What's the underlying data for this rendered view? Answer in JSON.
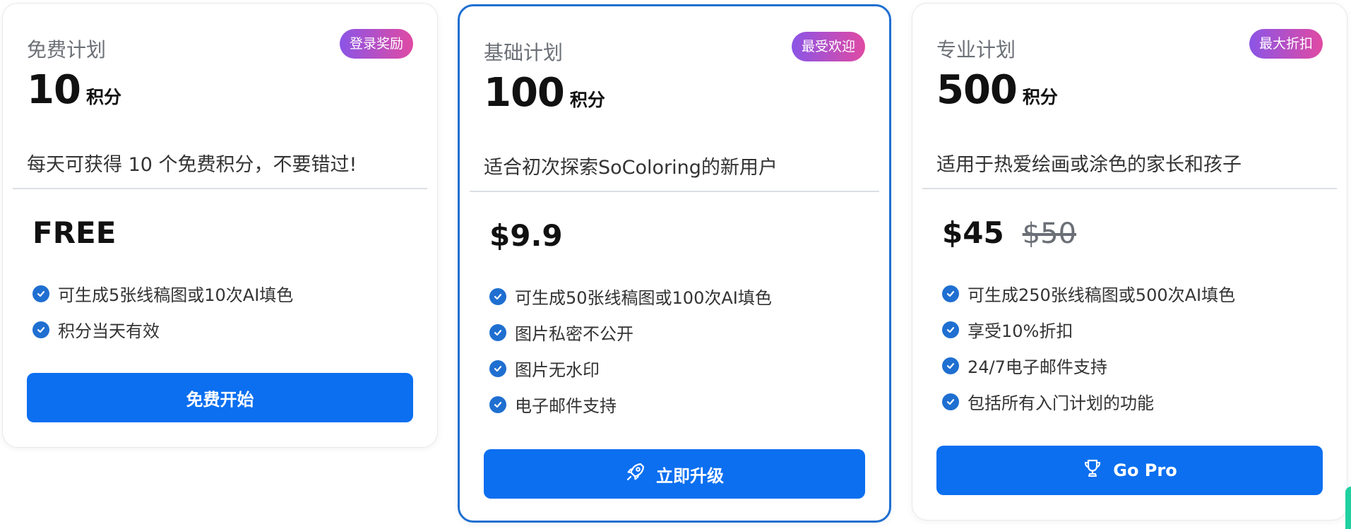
{
  "plans": [
    {
      "name": "免费计划",
      "badge": "登录奖励",
      "credits": "10",
      "credits_unit": "积分",
      "description": "每天可获得 10 个免费积分，不要错过!",
      "price": "FREE",
      "old_price": "",
      "features": [
        "可生成5张线稿图或10次AI填色",
        "积分当天有效"
      ],
      "cta_label": "免费开始",
      "cta_icon": ""
    },
    {
      "name": "基础计划",
      "badge": "最受欢迎",
      "credits": "100",
      "credits_unit": "积分",
      "description": "适合初次探索SoColoring的新用户",
      "price": "$9.9",
      "old_price": "",
      "features": [
        "可生成50张线稿图或100次AI填色",
        "图片私密不公开",
        "图片无水印",
        "电子邮件支持"
      ],
      "cta_label": "立即升级",
      "cta_icon": "rocket-icon"
    },
    {
      "name": "专业计划",
      "badge": "最大折扣",
      "credits": "500",
      "credits_unit": "积分",
      "description": "适用于热爱绘画或涂色的家长和孩子",
      "price": "$45",
      "old_price": "$50",
      "features": [
        "可生成250张线稿图或500次AI填色",
        "享受10%折扣",
        "24/7电子邮件支持",
        "包括所有入门计划的功能"
      ],
      "cta_label": "Go Pro",
      "cta_icon": "trophy-icon"
    }
  ],
  "colors": {
    "accent": "#0b6ff0",
    "highlight_border": "#1f6fd1",
    "badge_gradient": [
      "#8b55e6",
      "#e04aa3"
    ]
  }
}
